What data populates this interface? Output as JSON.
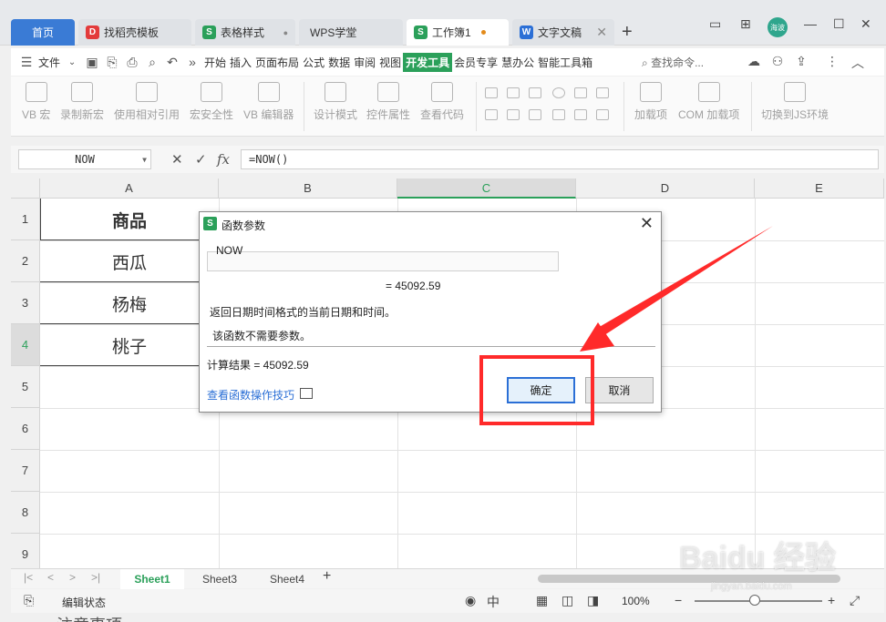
{
  "tabs": {
    "home": "首页",
    "items": [
      {
        "label": "找稻壳模板",
        "icon": "docer-icon",
        "color": "#e33b3b",
        "glyph": "D"
      },
      {
        "label": "表格样式",
        "icon": "sheet-icon",
        "color": "#2ba05a",
        "glyph": "S"
      },
      {
        "label": "WPS学堂",
        "icon": "",
        "color": "",
        "glyph": ""
      },
      {
        "label": "工作簿1",
        "icon": "sheet-icon",
        "color": "#2ba05a",
        "glyph": "S"
      },
      {
        "label": "文字文稿",
        "icon": "writer-icon",
        "color": "#2b6fd6",
        "glyph": "W"
      }
    ],
    "avatar_text": "海波"
  },
  "menu": {
    "file": "文件",
    "items": [
      "开始",
      "插入",
      "页面布局",
      "公式",
      "数据",
      "审阅",
      "视图",
      "开发工具",
      "会员专享",
      "慧办公",
      "智能工具箱"
    ],
    "active": "开发工具",
    "search": "查找命令..."
  },
  "ribbon": {
    "buttons": [
      "VB 宏",
      "录制新宏",
      "使用相对引用",
      "宏安全性",
      "VB 编辑器",
      "设计模式",
      "控件属性",
      "查看代码",
      "加载项",
      "COM 加载项",
      "切换到JS环境"
    ]
  },
  "formula_bar": {
    "name_box": "NOW",
    "formula": "=NOW()"
  },
  "grid": {
    "columns": [
      "A",
      "B",
      "C",
      "D",
      "E"
    ],
    "rows": [
      "1",
      "2",
      "3",
      "4",
      "5",
      "6",
      "7",
      "8",
      "9"
    ],
    "cells_a": [
      "商品",
      "西瓜",
      "杨梅",
      "桃子"
    ]
  },
  "dialog": {
    "title": "函数参数",
    "function_name": "NOW",
    "result_line": "= 45092.59",
    "description": "返回日期时间格式的当前日期和时间。",
    "no_args": "该函数不需要参数。",
    "calc_result": "计算结果 = 45092.59",
    "help_link": "查看函数操作技巧",
    "ok": "确定",
    "cancel": "取消"
  },
  "sheets": {
    "tabs": [
      "Sheet1",
      "Sheet3",
      "Sheet4"
    ],
    "active": "Sheet1"
  },
  "status": {
    "mode": "编辑状态",
    "zoom": "100%"
  },
  "bottom_text": "注意事项",
  "watermark": {
    "main": "Baidu 经验",
    "sub": "jingyan.baidu.com"
  },
  "colors": {
    "accent": "#2ba05a",
    "highlight": "#ff2a2a",
    "link": "#2b6fd6"
  }
}
